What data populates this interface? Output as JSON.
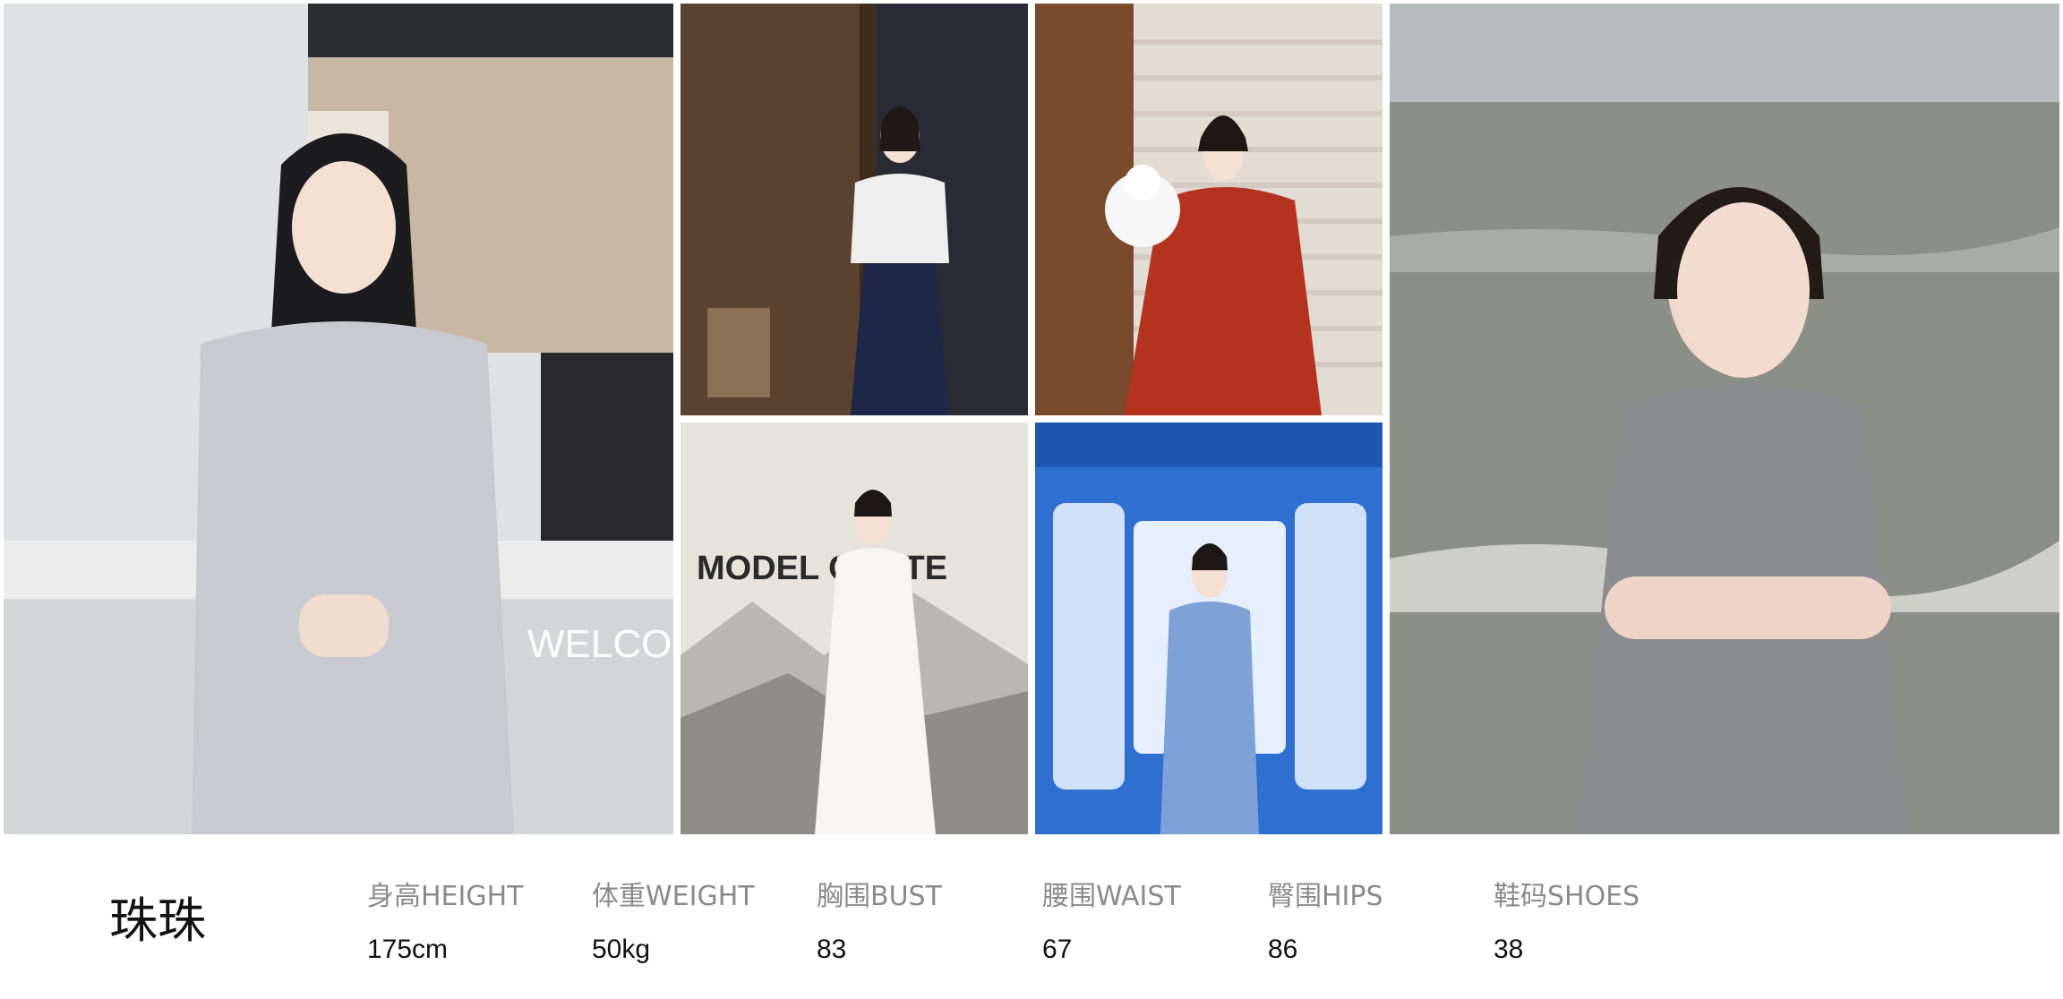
{
  "photos": [
    {
      "scene": "woman in grey dress at reception desk",
      "sign_text": "WELCOM"
    },
    {
      "scene": "woman presenting at event stage",
      "sign_text": ""
    },
    {
      "scene": "woman in red hanfu on stairs with mascot",
      "sign_text": ""
    },
    {
      "scene": "woman in white qipao in front of ink painting backdrop",
      "sign_text": "MODEL CONTE"
    },
    {
      "scene": "woman in blue suit before blue exhibition board",
      "sign_text": ""
    },
    {
      "scene": "woman with braid in grey dress at seashore",
      "sign_text": ""
    }
  ],
  "profile": {
    "name": "珠珠",
    "stats": [
      {
        "label": "身高HEIGHT",
        "value": "175cm"
      },
      {
        "label": "体重WEIGHT",
        "value": "50kg"
      },
      {
        "label": "胸围BUST",
        "value": "83"
      },
      {
        "label": "腰围WAIST",
        "value": "67"
      },
      {
        "label": "臀围HIPS",
        "value": "86"
      },
      {
        "label": "鞋码SHOES",
        "value": "38"
      }
    ]
  }
}
